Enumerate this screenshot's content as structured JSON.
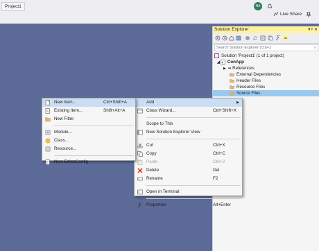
{
  "window": {
    "tab_title": "Project1",
    "avatar": "NA",
    "live_share": "Live Share"
  },
  "solution_explorer": {
    "title": "Solution Explorer",
    "header_buttons": "▾ ᵖ ✕",
    "search_placeholder": "Search Solution Explorer (Ctrl+;)",
    "tree": [
      {
        "label": "Solution 'Project1' (1 of 1 project)",
        "icon": "solution-icon"
      },
      {
        "label": "ConApp",
        "icon": "project-icon"
      },
      {
        "label": "References",
        "icon": "references-icon"
      },
      {
        "label": "External Dependencies",
        "icon": "folder-icon"
      },
      {
        "label": "Header Files",
        "icon": "folder-icon"
      },
      {
        "label": "Resource Files",
        "icon": "folder-icon"
      },
      {
        "label": "Source Files",
        "icon": "folder-icon"
      }
    ]
  },
  "context_menu": {
    "items": [
      {
        "label": "Add",
        "shortcut": "",
        "icon": ""
      },
      {
        "label": "Class Wizard...",
        "shortcut": "Ctrl+Shift+X",
        "icon": "class-wizard-icon"
      },
      {
        "label": "Scope to This",
        "shortcut": "",
        "icon": ""
      },
      {
        "label": "New Solution Explorer View",
        "shortcut": "",
        "icon": "new-view-icon"
      },
      {
        "label": "Cut",
        "shortcut": "Ctrl+X",
        "icon": "cut-icon"
      },
      {
        "label": "Copy",
        "shortcut": "Ctrl+C",
        "icon": "copy-icon"
      },
      {
        "label": "Paste",
        "shortcut": "Ctrl+V",
        "icon": "paste-icon"
      },
      {
        "label": "Delete",
        "shortcut": "Del",
        "icon": "delete-icon"
      },
      {
        "label": "Rename",
        "shortcut": "F2",
        "icon": "rename-icon"
      },
      {
        "label": "Open in Terminal",
        "shortcut": "",
        "icon": "terminal-icon"
      },
      {
        "label": "Properties",
        "shortcut": "Alt+Enter",
        "icon": "wrench-icon"
      }
    ]
  },
  "add_submenu": {
    "items": [
      {
        "label": "New Item...",
        "shortcut": "Ctrl+Shift+A",
        "icon": "new-item-icon"
      },
      {
        "label": "Existing Item...",
        "shortcut": "Shift+Alt+A",
        "icon": "existing-item-icon"
      },
      {
        "label": "New Filter",
        "shortcut": "",
        "icon": "folder-icon"
      },
      {
        "label": "Module...",
        "shortcut": "",
        "icon": "module-icon"
      },
      {
        "label": "Class...",
        "shortcut": "",
        "icon": "class-icon"
      },
      {
        "label": "Resource...",
        "shortcut": "",
        "icon": "resource-icon"
      },
      {
        "label": "New EditorConfig",
        "shortcut": "",
        "icon": "editorconfig-icon"
      }
    ]
  },
  "colors": {
    "accent": "#fff29d",
    "selection": "#99c9ef",
    "highlight": "#c9def5",
    "background": "#5d6b99"
  }
}
